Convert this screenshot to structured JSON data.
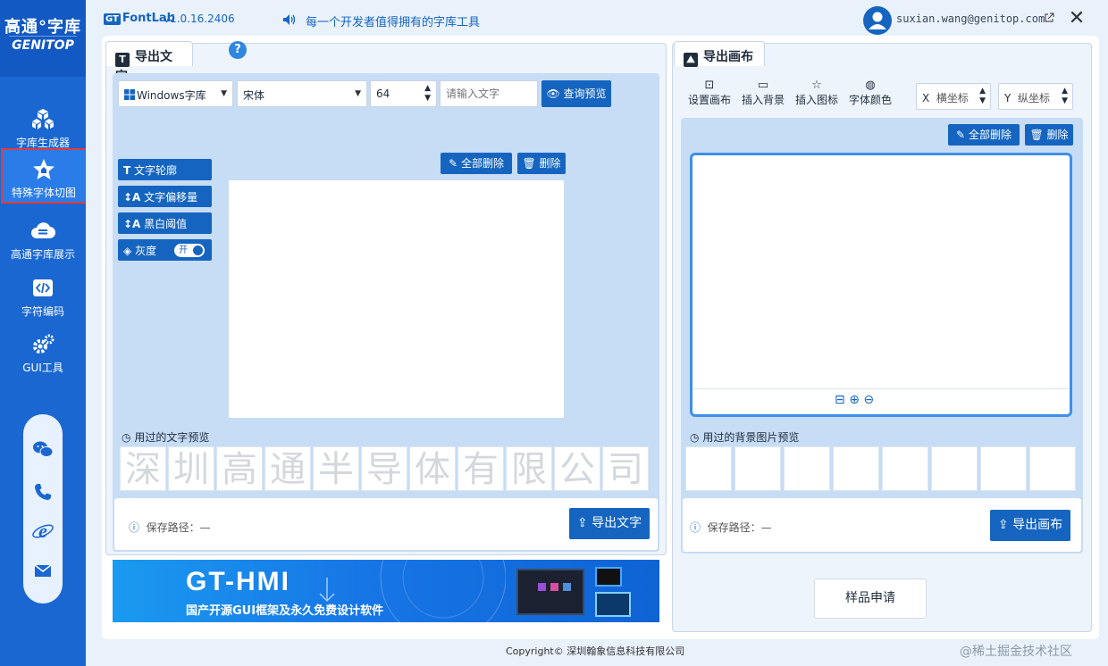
{
  "app": {
    "logo_line1": "高通°字库",
    "logo_line2": "GENITOP",
    "brand": "FontLab",
    "brand_badge": "GT",
    "version": "v1.0.16.2406",
    "slogan": "每一个开发者值得拥有的字库工具",
    "user_email": "suxian.wang@genitop.com",
    "close_label": "✕"
  },
  "sidebar": {
    "items": [
      {
        "label": "字库生成器",
        "icon": "cubes-icon"
      },
      {
        "label": "特殊字体切图",
        "icon": "star-shape-icon",
        "active": true
      },
      {
        "label": "高通字库展示",
        "icon": "cloud-list-icon"
      },
      {
        "label": "字符编码",
        "icon": "code-icon"
      },
      {
        "label": "GUI工具",
        "icon": "gears-icon"
      }
    ],
    "contact_icons": [
      "wechat-icon",
      "phone-icon",
      "ie-icon",
      "mail-icon"
    ]
  },
  "left_panel": {
    "tab_title": "导出文字",
    "help_label": "?",
    "font_source": "Windows字库",
    "font_name": "宋体",
    "font_size": "64",
    "text_placeholder": "请输入文字",
    "query_button": "查询预览",
    "clear_all_button": "全部删除",
    "delete_button": "删除",
    "options": [
      "文字轮廓",
      "文字偏移量",
      "黑白阈值",
      "灰度"
    ],
    "toggle_label": "开",
    "history_label": "用过的文字预览",
    "history_chars": [
      "深",
      "圳",
      "高",
      "通",
      "半",
      "导",
      "体",
      "有",
      "限",
      "公",
      "司"
    ],
    "save_path_label": "保存路径：—",
    "export_button": "导出文字"
  },
  "right_panel": {
    "tab_title": "导出画布",
    "tools": [
      "设置画布",
      "插入背景",
      "插入图标",
      "字体颜色"
    ],
    "x_label": "X",
    "x_placeholder": "横坐标",
    "y_label": "Y",
    "y_placeholder": "纵坐标",
    "clear_all_button": "全部删除",
    "delete_button": "删除",
    "history_label": "用过的背景图片预览",
    "save_path_label": "保存路径：—",
    "export_button": "导出画布",
    "sample_button": "样品申请"
  },
  "banner": {
    "title": "GT-HMI",
    "subtitle": "国产开源GUI框架及永久免费设计软件"
  },
  "footer": {
    "copyright": "Copyright© 深圳翰象信息科技有限公司",
    "watermark": "@稀土掘金技术社区"
  }
}
